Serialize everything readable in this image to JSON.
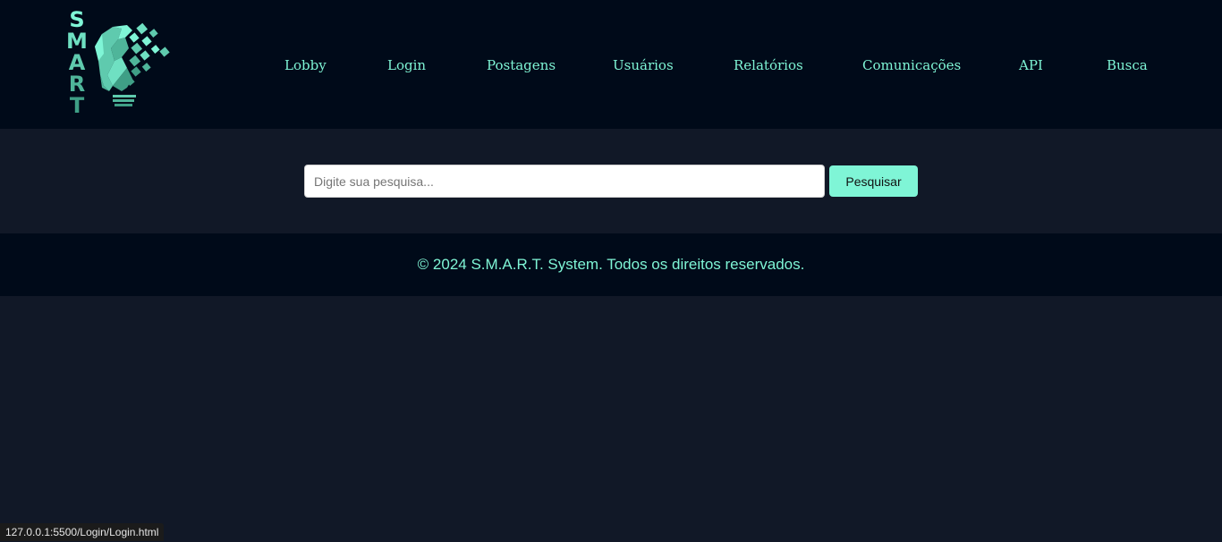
{
  "brand": {
    "letters": [
      "S",
      "M",
      "A",
      "R",
      "T"
    ],
    "logo_icon": "lightbulb-pixels-icon",
    "accent_color": "#7ff5d6",
    "letter_colors": [
      "#7ff5d6",
      "#6fe0c2",
      "#5fcaae",
      "#4fb59a",
      "#3f9f86"
    ]
  },
  "nav": {
    "items": [
      {
        "label": "Lobby"
      },
      {
        "label": "Login"
      },
      {
        "label": "Postagens"
      },
      {
        "label": "Usuários"
      },
      {
        "label": "Relatórios"
      },
      {
        "label": "Comunicações"
      },
      {
        "label": "API"
      },
      {
        "label": "Busca"
      }
    ]
  },
  "search": {
    "value": "",
    "placeholder": "Digite sua pesquisa...",
    "button_label": "Pesquisar",
    "button_color": "#7ff5d6"
  },
  "footer": {
    "text": "© 2024 S.M.A.R.T. System. Todos os direitos reservados.",
    "color": "#7ff5d6"
  },
  "status_bar": {
    "url": "127.0.0.1:5500/Login/Login.html"
  }
}
